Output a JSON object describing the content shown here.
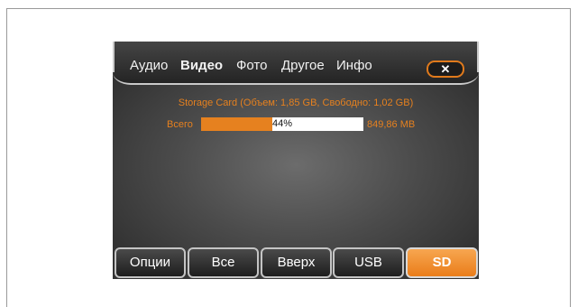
{
  "tabs": [
    {
      "label": "Аудио",
      "active": false
    },
    {
      "label": "Видео",
      "active": true
    },
    {
      "label": "Фото",
      "active": false
    },
    {
      "label": "Другое",
      "active": false
    },
    {
      "label": "Инфо",
      "active": false
    }
  ],
  "close_label": "✕",
  "storage_info": "Storage Card (Объем: 1,85 GB, Свободно: 1,02 GB)",
  "usage": {
    "total_label": "Всего",
    "percent_text": "44%",
    "percent": 44,
    "size_label": "849,86 MB"
  },
  "buttons": {
    "options": "Опции",
    "all": "Все",
    "up": "Вверх",
    "usb": "USB",
    "sd": "SD"
  },
  "colors": {
    "accent": "#e6811f",
    "screen_bg": "#4b4b4b",
    "active_button": "#ea7d1a"
  }
}
